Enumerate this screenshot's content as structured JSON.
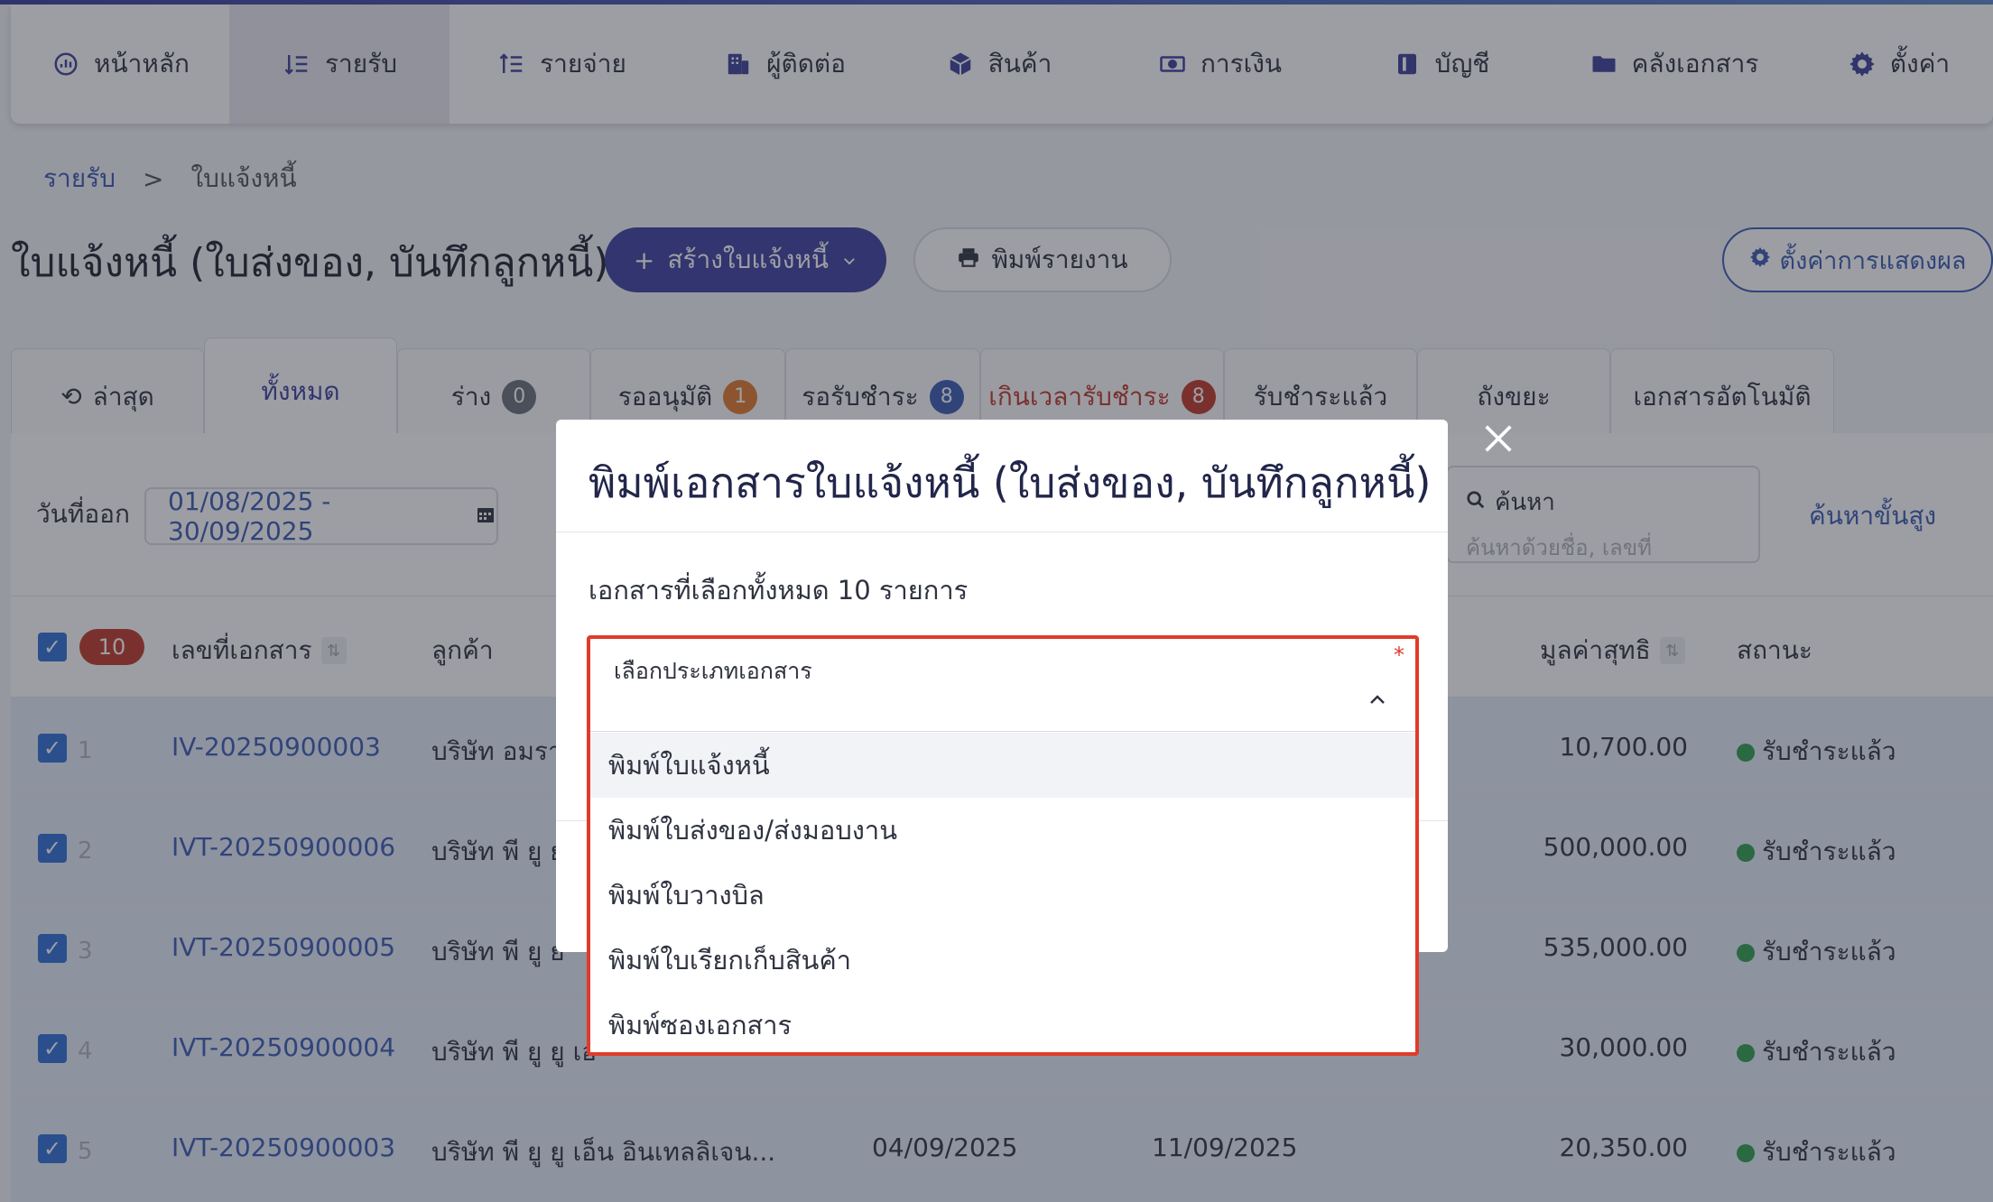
{
  "nav": {
    "items": [
      {
        "label": "หน้าหลัก",
        "icon": "dashboard-icon"
      },
      {
        "label": "รายรับ",
        "icon": "income-icon"
      },
      {
        "label": "รายจ่าย",
        "icon": "expense-icon"
      },
      {
        "label": "ผู้ติดต่อ",
        "icon": "contacts-icon"
      },
      {
        "label": "สินค้า",
        "icon": "box-icon"
      },
      {
        "label": "การเงิน",
        "icon": "money-icon"
      },
      {
        "label": "บัญชี",
        "icon": "ledger-icon"
      },
      {
        "label": "คลังเอกสาร",
        "icon": "folder-icon"
      },
      {
        "label": "ตั้งค่า",
        "icon": "gear-icon"
      }
    ]
  },
  "breadcrumb": {
    "parent": "รายรับ",
    "separator": ">",
    "current": "ใบแจ้งหนี้"
  },
  "header": {
    "title": "ใบแจ้งหนี้ (ใบส่งของ, บันทึกลูกหนี้)",
    "create_button": "สร้างใบแจ้งหนี้",
    "create_button_prefix": "+",
    "print_report_button": "พิมพ์รายงาน",
    "display_settings_button": "ตั้งค่าการแสดงผล"
  },
  "tabs": [
    {
      "label": "ล่าสุด",
      "prefix": "⟲"
    },
    {
      "label": "ทั้งหมด"
    },
    {
      "label": "ร่าง",
      "badge": "0",
      "badge_color": "#6b6f7a"
    },
    {
      "label": "รออนุมัติ",
      "badge": "1",
      "badge_color": "#e07b2c"
    },
    {
      "label": "รอรับชำระ",
      "badge": "8",
      "badge_color": "#3a5bb5"
    },
    {
      "label": "เกินเวลารับชำระ",
      "badge": "8",
      "badge_color": "#c0392b"
    },
    {
      "label": "รับชำระแล้ว"
    },
    {
      "label": "ถังขยะ"
    },
    {
      "label": "เอกสารอัตโนมัติ"
    }
  ],
  "filter": {
    "date_label": "วันที่ออก",
    "date_range": "01/08/2025 - 30/09/2025",
    "search_label": "ค้นหา",
    "search_placeholder": "ค้นหาด้วยชื่อ, เลขที่",
    "advanced_search": "ค้นหาขั้นสูง"
  },
  "table": {
    "selected_count": "10",
    "headers": {
      "doc_no": "เลขที่เอกสาร",
      "customer": "ลูกค้า",
      "net_value": "มูลค่าสุทธิ",
      "status": "สถานะ"
    },
    "rows": [
      {
        "num": "1",
        "doc_no": "IV-20250900003",
        "customer": "บริษัท อมรา",
        "issue_date": "",
        "due_date": "",
        "amount": "10,700.00",
        "status": "รับชำระแล้ว"
      },
      {
        "num": "2",
        "doc_no": "IVT-20250900006",
        "customer": "บริษัท พี ยู ย",
        "issue_date": "",
        "due_date": "",
        "amount": "500,000.00",
        "status": "รับชำระแล้ว"
      },
      {
        "num": "3",
        "doc_no": "IVT-20250900005",
        "customer": "บริษัท พี ยู ย",
        "issue_date": "",
        "due_date": "",
        "amount": "535,000.00",
        "status": "รับชำระแล้ว"
      },
      {
        "num": "4",
        "doc_no": "IVT-20250900004",
        "customer": "บริษัท พี ยู ยู เอ",
        "issue_date": "",
        "due_date": "",
        "amount": "30,000.00",
        "status": "รับชำระแล้ว"
      },
      {
        "num": "5",
        "doc_no": "IVT-20250900003",
        "customer": "บริษัท พี ยู ยู เอ็น อินเทลลิเจน...",
        "issue_date": "04/09/2025",
        "due_date": "11/09/2025",
        "amount": "20,350.00",
        "status": "รับชำระแล้ว"
      }
    ]
  },
  "modal": {
    "title": "พิมพ์เอกสารใบแจ้งหนี้ (ใบส่งของ, บันทึกลูกหนี้)",
    "selected_text": "เอกสารที่เลือกทั้งหมด 10 รายการ",
    "select_label": "เลือกประเภทเอกสาร",
    "required_mark": "*",
    "options": [
      "พิมพ์ใบแจ้งหนี้",
      "พิมพ์ใบส่งของ/ส่งมอบงาน",
      "พิมพ์ใบวางบิล",
      "พิมพ์ใบเรียกเก็บสินค้า",
      "พิมพ์ซองเอกสาร"
    ]
  },
  "colors": {
    "primary": "#3d40a0",
    "link": "#3a5bb5",
    "danger": "#c0392b",
    "highlight_border": "#e03b2b",
    "status_paid": "#2e9e4f"
  }
}
